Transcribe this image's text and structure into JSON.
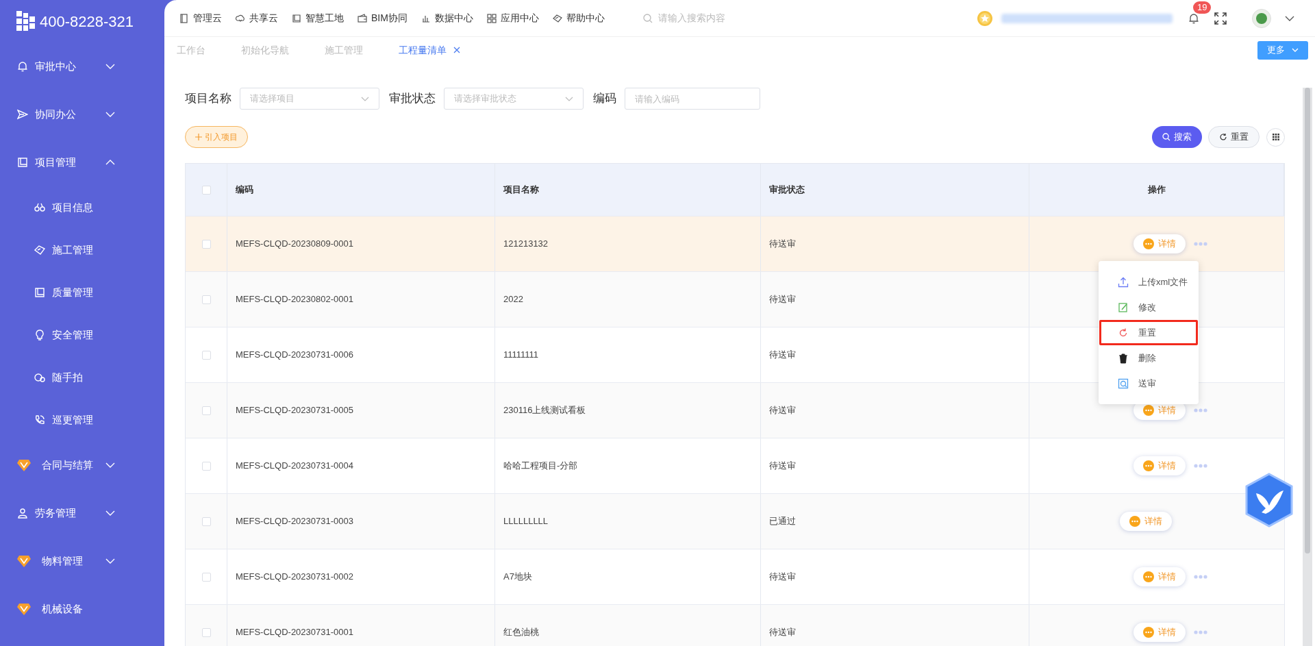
{
  "logo": {
    "phone": "400-8228-321"
  },
  "sidebar": {
    "items": [
      {
        "kind": "group",
        "label": "审批中心",
        "expanded": false
      },
      {
        "kind": "group",
        "label": "协同办公",
        "expanded": false
      },
      {
        "kind": "group",
        "label": "项目管理",
        "expanded": true,
        "children": [
          {
            "label": "项目信息"
          },
          {
            "label": "施工管理"
          },
          {
            "label": "质量管理"
          },
          {
            "label": "安全管理"
          },
          {
            "label": "随手拍"
          },
          {
            "label": "巡更管理"
          }
        ]
      },
      {
        "kind": "group",
        "label": "合同与结算",
        "expanded": false
      },
      {
        "kind": "group",
        "label": "劳务管理",
        "expanded": false
      },
      {
        "kind": "group",
        "label": "物料管理",
        "expanded": false
      },
      {
        "kind": "link",
        "label": "机械设备"
      }
    ]
  },
  "top_nav": [
    "管理云",
    "共享云",
    "智慧工地",
    "BIM协同",
    "数据中心",
    "应用中心",
    "帮助中心"
  ],
  "search": {
    "placeholder": "请输入搜索内容"
  },
  "notifications": {
    "count": "19"
  },
  "tabs": [
    {
      "label": "工作台",
      "selected": false
    },
    {
      "label": "初始化导航",
      "selected": false
    },
    {
      "label": "施工管理",
      "selected": false
    },
    {
      "label": "工程量清单",
      "selected": true,
      "closable": true
    }
  ],
  "more_button": "更多",
  "filters": [
    {
      "label": "项目名称",
      "kind": "select",
      "placeholder": "请选择项目"
    },
    {
      "label": "审批状态",
      "kind": "select",
      "placeholder": "请选择审批状态"
    },
    {
      "label": "编码",
      "kind": "input",
      "placeholder": "请输入编码"
    }
  ],
  "import_button": "引入项目",
  "search_button": "搜索",
  "reset_button": "重置",
  "table": {
    "select_all_checked": false,
    "columns": [
      "编码",
      "项目名称",
      "审批状态",
      "操作"
    ],
    "rows": [
      {
        "code": "MEFS-CLQD-20230809-0001",
        "name": "121213132",
        "status": "待送审",
        "action": "详情",
        "more": true,
        "highlighted": true
      },
      {
        "code": "MEFS-CLQD-20230802-0001",
        "name": "2022",
        "status": "待送审",
        "highlighted": false
      },
      {
        "code": "MEFS-CLQD-20230731-0006",
        "name": "11111111",
        "status": "待送审",
        "highlighted": false
      },
      {
        "code": "MEFS-CLQD-20230731-0005",
        "name": "230116上线测试看板",
        "status": "待送审",
        "action": "详情",
        "more": true,
        "highlighted": false
      },
      {
        "code": "MEFS-CLQD-20230731-0004",
        "name": "哈哈工程项目-分部",
        "status": "待送审",
        "action": "详情",
        "more": true,
        "highlighted": false
      },
      {
        "code": "MEFS-CLQD-20230731-0003",
        "name": "LLLLLLLLL",
        "status": "已通过",
        "action": "详情",
        "more": false,
        "highlighted": false
      },
      {
        "code": "MEFS-CLQD-20230731-0002",
        "name": "A7地块",
        "status": "待送审",
        "action": "详情",
        "more": true,
        "highlighted": false
      },
      {
        "code": "MEFS-CLQD-20230731-0001",
        "name": "红色油桃",
        "status": "待送审",
        "action": "详情",
        "more": true,
        "highlighted": false
      }
    ]
  },
  "row_menu": {
    "items": [
      {
        "label": "上传xml文件",
        "highlighted": false
      },
      {
        "label": "修改",
        "highlighted": false
      },
      {
        "label": "重置",
        "highlighted": true
      },
      {
        "label": "删除",
        "highlighted": false
      },
      {
        "label": "送审",
        "highlighted": false
      }
    ]
  }
}
